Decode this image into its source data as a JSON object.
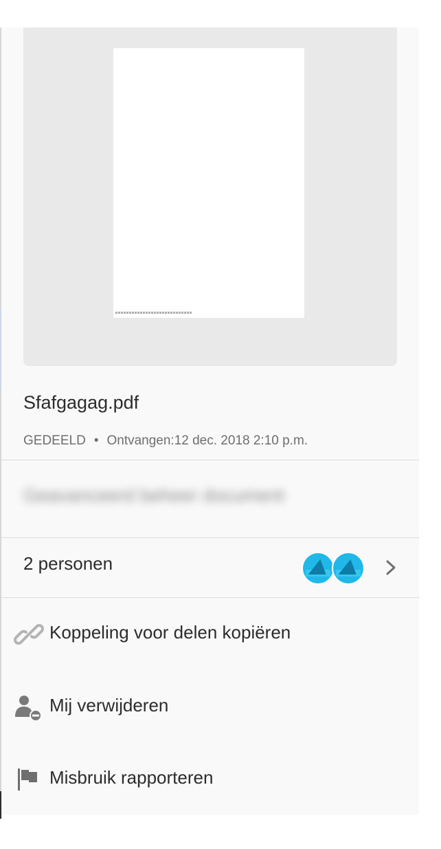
{
  "file": {
    "name": "Sfafgagag.pdf",
    "status": "GEDEELD",
    "separator": "•",
    "received": "Ontvangen:12 dec. 2018 2:10 p.m."
  },
  "blurred_row": {
    "label": "Geavanceerd beheer document"
  },
  "people": {
    "label": "2 personen",
    "count": 2
  },
  "actions": {
    "copy_link": "Koppeling voor delen kopiëren",
    "remove_me": "Mij verwijderen",
    "report_abuse": "Misbruik rapporteren"
  },
  "colors": {
    "panel_bg": "#f9f9f9",
    "preview_bg": "#e9e9e9",
    "avatar": "#1fb8e8",
    "text": "#2c2c2c",
    "muted": "#6e6e6e"
  },
  "icons": {
    "copy_link": "link-icon",
    "remove_me": "remove-user-icon",
    "report_abuse": "flag-icon",
    "people_arrow": "chevron-right-icon"
  }
}
